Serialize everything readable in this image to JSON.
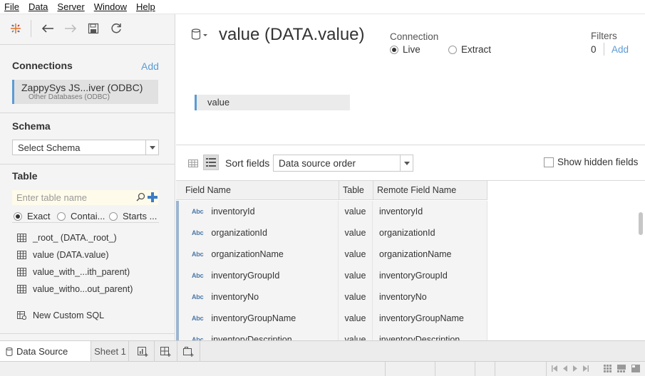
{
  "menu": {
    "items": [
      "File",
      "Data",
      "Server",
      "Window",
      "Help"
    ]
  },
  "icons": {
    "logo": "tableau-logo-icon",
    "back": "undo-arrow-icon",
    "forward": "redo-arrow-icon",
    "save": "save-icon",
    "refresh": "refresh-icon"
  },
  "left": {
    "connections_title": "Connections",
    "connections_add": "Add",
    "connection_name": "ZappySys JS...iver (ODBC)",
    "connection_sub": "Other Databases (ODBC)",
    "schema_title": "Schema",
    "schema_value": "Select Schema",
    "table_title": "Table",
    "table_search_placeholder": "Enter table name",
    "match_options": [
      "Exact",
      "Contai...",
      "Starts ..."
    ],
    "tables": [
      "_root_ (DATA._root_)",
      "value (DATA.value)",
      "value_with_...ith_parent)",
      "value_witho...out_parent)"
    ],
    "custom_sql": "New Custom SQL"
  },
  "datasource": {
    "title": "value (DATA.value)",
    "connection_label": "Connection",
    "live_label": "Live",
    "extract_label": "Extract",
    "filters_label": "Filters",
    "filters_count": "0",
    "filters_add": "Add",
    "card_label": "value"
  },
  "grid_toolbar": {
    "sort_label": "Sort fields",
    "sort_value": "Data source order",
    "show_hidden_label": "Show hidden fields"
  },
  "grid": {
    "columns": [
      "Field Name",
      "Table",
      "Remote Field Name"
    ],
    "type_badge": "Abc",
    "rows": [
      {
        "field": "inventoryId",
        "table": "value",
        "remote": "inventoryId"
      },
      {
        "field": "organizationId",
        "table": "value",
        "remote": "organizationId"
      },
      {
        "field": "organizationName",
        "table": "value",
        "remote": "organizationName"
      },
      {
        "field": "inventoryGroupId",
        "table": "value",
        "remote": "inventoryGroupId"
      },
      {
        "field": "inventoryNo",
        "table": "value",
        "remote": "inventoryNo"
      },
      {
        "field": "inventoryGroupName",
        "table": "value",
        "remote": "inventoryGroupName"
      },
      {
        "field": "inventoryDescription",
        "table": "value",
        "remote": "inventoryDescription"
      }
    ]
  },
  "tabs": {
    "data_source": "Data Source",
    "sheet1": "Sheet 1"
  },
  "colors": {
    "accent": "#5b9bd5",
    "type_badge": "#4a78a8"
  }
}
